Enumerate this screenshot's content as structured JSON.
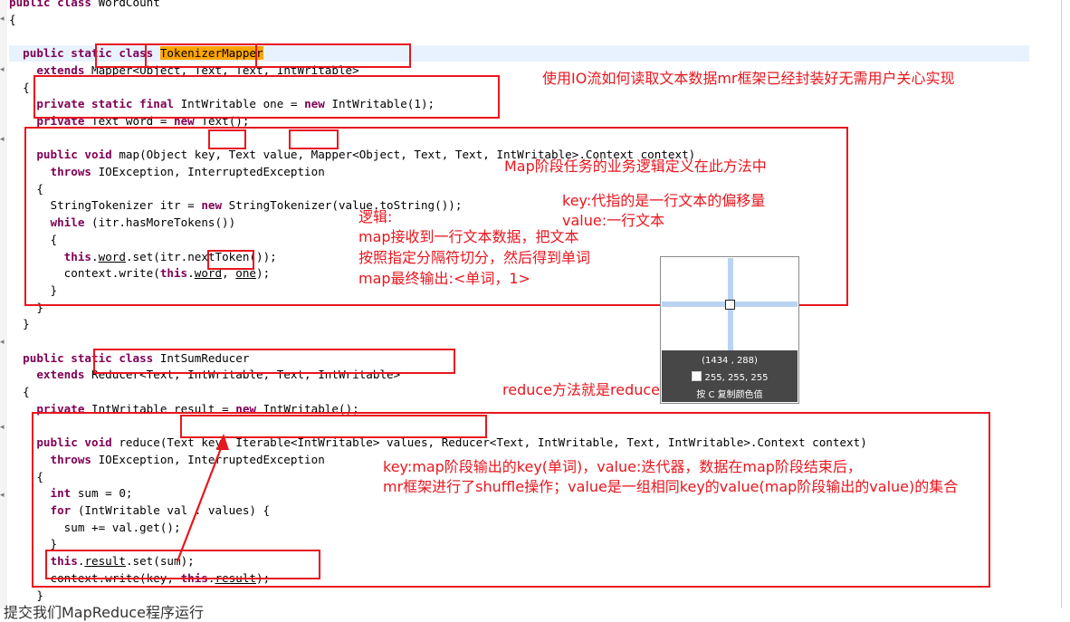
{
  "code": {
    "lines": [
      [
        {
          "t": "public class ",
          "c": "kw"
        },
        {
          "t": "WordCount"
        }
      ],
      [
        {
          "t": "{"
        }
      ],
      [],
      [
        {
          "t": "  "
        },
        {
          "t": "public static class ",
          "c": "kw"
        },
        {
          "t": "TokenizerMapper",
          "c": "mk"
        }
      ],
      [
        {
          "t": "    "
        },
        {
          "t": "extends ",
          "c": "kw"
        },
        {
          "t": "Mapper<Object, Text, Text, IntWritable>"
        }
      ],
      [
        {
          "t": "  {"
        }
      ],
      [
        {
          "t": "    "
        },
        {
          "t": "private static final ",
          "c": "kw"
        },
        {
          "t": "IntWritable one = "
        },
        {
          "t": "new ",
          "c": "kw"
        },
        {
          "t": "IntWritable(1);"
        }
      ],
      [
        {
          "t": "    "
        },
        {
          "t": "private ",
          "c": "kw"
        },
        {
          "t": "Text word = "
        },
        {
          "t": "new ",
          "c": "kw"
        },
        {
          "t": "Text();"
        }
      ],
      [],
      [
        {
          "t": "    "
        },
        {
          "t": "public void ",
          "c": "kw"
        },
        {
          "t": "map(Object key, Text value, Mapper<Object, Text, Text, IntWritable>.Context context)"
        }
      ],
      [
        {
          "t": "      "
        },
        {
          "t": "throws ",
          "c": "kw"
        },
        {
          "t": "IOException, InterruptedException"
        }
      ],
      [
        {
          "t": "    {"
        }
      ],
      [
        {
          "t": "      StringTokenizer itr = "
        },
        {
          "t": "new ",
          "c": "kw"
        },
        {
          "t": "StringTokenizer(value.toString());"
        }
      ],
      [
        {
          "t": "      "
        },
        {
          "t": "while ",
          "c": "kw"
        },
        {
          "t": "(itr.hasMoreTokens())"
        }
      ],
      [
        {
          "t": "      {"
        }
      ],
      [
        {
          "t": "        "
        },
        {
          "t": "this",
          "c": "kw"
        },
        {
          "t": "."
        },
        {
          "t": "word",
          "c": "ul"
        },
        {
          "t": ".set(itr.nextToken());"
        }
      ],
      [
        {
          "t": "        context.write("
        },
        {
          "t": "this",
          "c": "kw"
        },
        {
          "t": "."
        },
        {
          "t": "word",
          "c": "ul"
        },
        {
          "t": ", "
        },
        {
          "t": "one",
          "c": "ul"
        },
        {
          "t": ");"
        }
      ],
      [
        {
          "t": "      }"
        }
      ],
      [
        {
          "t": "    }"
        }
      ],
      [
        {
          "t": "  }"
        }
      ],
      [],
      [
        {
          "t": "  "
        },
        {
          "t": "public static class ",
          "c": "kw"
        },
        {
          "t": "IntSumReducer"
        }
      ],
      [
        {
          "t": "    "
        },
        {
          "t": "extends ",
          "c": "kw"
        },
        {
          "t": "Reducer<Text, IntWritable, Text, IntWritable>"
        }
      ],
      [
        {
          "t": "  {"
        }
      ],
      [
        {
          "t": "    "
        },
        {
          "t": "private ",
          "c": "kw"
        },
        {
          "t": "IntWritable result = "
        },
        {
          "t": "new ",
          "c": "kw"
        },
        {
          "t": "IntWritable();"
        }
      ],
      [],
      [
        {
          "t": "    "
        },
        {
          "t": "public void ",
          "c": "kw"
        },
        {
          "t": "reduce(Text key, Iterable<IntWritable> values, Reducer<Text, IntWritable, Text, IntWritable>.Context context)"
        }
      ],
      [
        {
          "t": "      "
        },
        {
          "t": "throws ",
          "c": "kw"
        },
        {
          "t": "IOException, InterruptedException"
        }
      ],
      [
        {
          "t": "    {"
        }
      ],
      [
        {
          "t": "      "
        },
        {
          "t": "int ",
          "c": "kw"
        },
        {
          "t": "sum = 0;"
        }
      ],
      [
        {
          "t": "      "
        },
        {
          "t": "for ",
          "c": "kw"
        },
        {
          "t": "(IntWritable val : values) {"
        }
      ],
      [
        {
          "t": "        sum += val.get();"
        }
      ],
      [
        {
          "t": "      }"
        }
      ],
      [
        {
          "t": "      "
        },
        {
          "t": "this",
          "c": "kw"
        },
        {
          "t": "."
        },
        {
          "t": "result",
          "c": "ul"
        },
        {
          "t": ".set(sum);"
        }
      ],
      [
        {
          "t": "      context.write(key, "
        },
        {
          "t": "this",
          "c": "kw"
        },
        {
          "t": "."
        },
        {
          "t": "result",
          "c": "ul"
        },
        {
          "t": ");"
        }
      ],
      [
        {
          "t": "    }"
        }
      ],
      [
        {
          "t": "  }"
        }
      ]
    ]
  },
  "notes": {
    "n1": "使用IO流如何读取文本数据mr框架已经封装好无需用户关心实现",
    "n2": "Map阶段任务的业务逻辑定义在此方法中",
    "n3a": "key:代指的是一行文本的偏移量",
    "n3b": "value:一行文本",
    "n4a": "逻辑:",
    "n4b": "map接收到一行文本数据，把文本",
    "n4c": "按照指定分隔符切分，然后得到单词",
    "n4d": "map最终输出:<单词，1>",
    "n5": "reduce方法就是reduce阶段的业务逻辑",
    "n6a": "key:map阶段输出的key(单词)，value:迭代器，数据在map阶段结束后，",
    "n6b": "mr框架进行了shuffle操作；value是一组相同key的value(map阶段输出的value)的集合"
  },
  "color_picker": {
    "coords": "(1434 , 288)",
    "rgb": "255, 255, 255",
    "hint": "按 C 复制颜色值"
  },
  "bottom_text": "提交我们MapReduce程序运行",
  "colors": {
    "annotation": "#e8161e",
    "keyword": "#7f0055",
    "marker": "#ffa500",
    "current_line": "#e8f2fe"
  }
}
